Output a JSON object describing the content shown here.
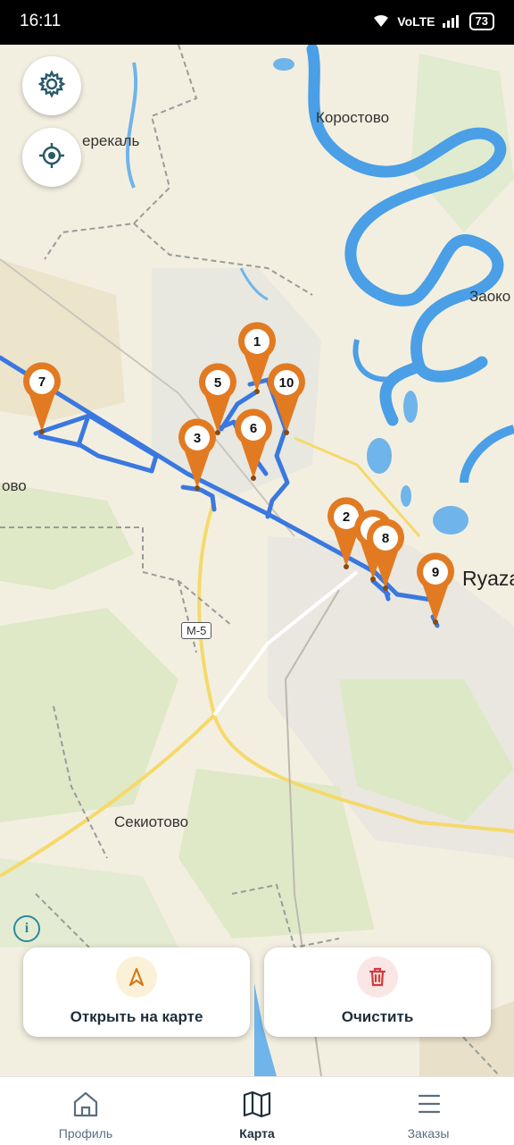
{
  "status_bar": {
    "time": "16:11",
    "network": "VoLTE",
    "battery": "73"
  },
  "map": {
    "place_labels": [
      "Коростово",
      "ерекаль",
      "Заоко",
      "ово",
      "Секиотово"
    ],
    "city_label": "Ryaza",
    "road_sign": "M-5",
    "markers": [
      "1",
      "2",
      "3",
      "4",
      "5",
      "6",
      "7",
      "8",
      "9",
      "10"
    ],
    "colors": {
      "route": "#3a78e0",
      "marker": "#e27a22",
      "river": "#4a9fe6"
    }
  },
  "controls": {
    "settings": "gear-icon",
    "locate": "target-icon",
    "info": "i"
  },
  "actions": {
    "open_map": "Открыть на карте",
    "clear": "Очистить"
  },
  "tabs": [
    {
      "label": "Профиль",
      "icon": "home-icon"
    },
    {
      "label": "Карта",
      "icon": "map-icon"
    },
    {
      "label": "Заказы",
      "icon": "list-icon"
    }
  ],
  "active_tab": "Карта"
}
